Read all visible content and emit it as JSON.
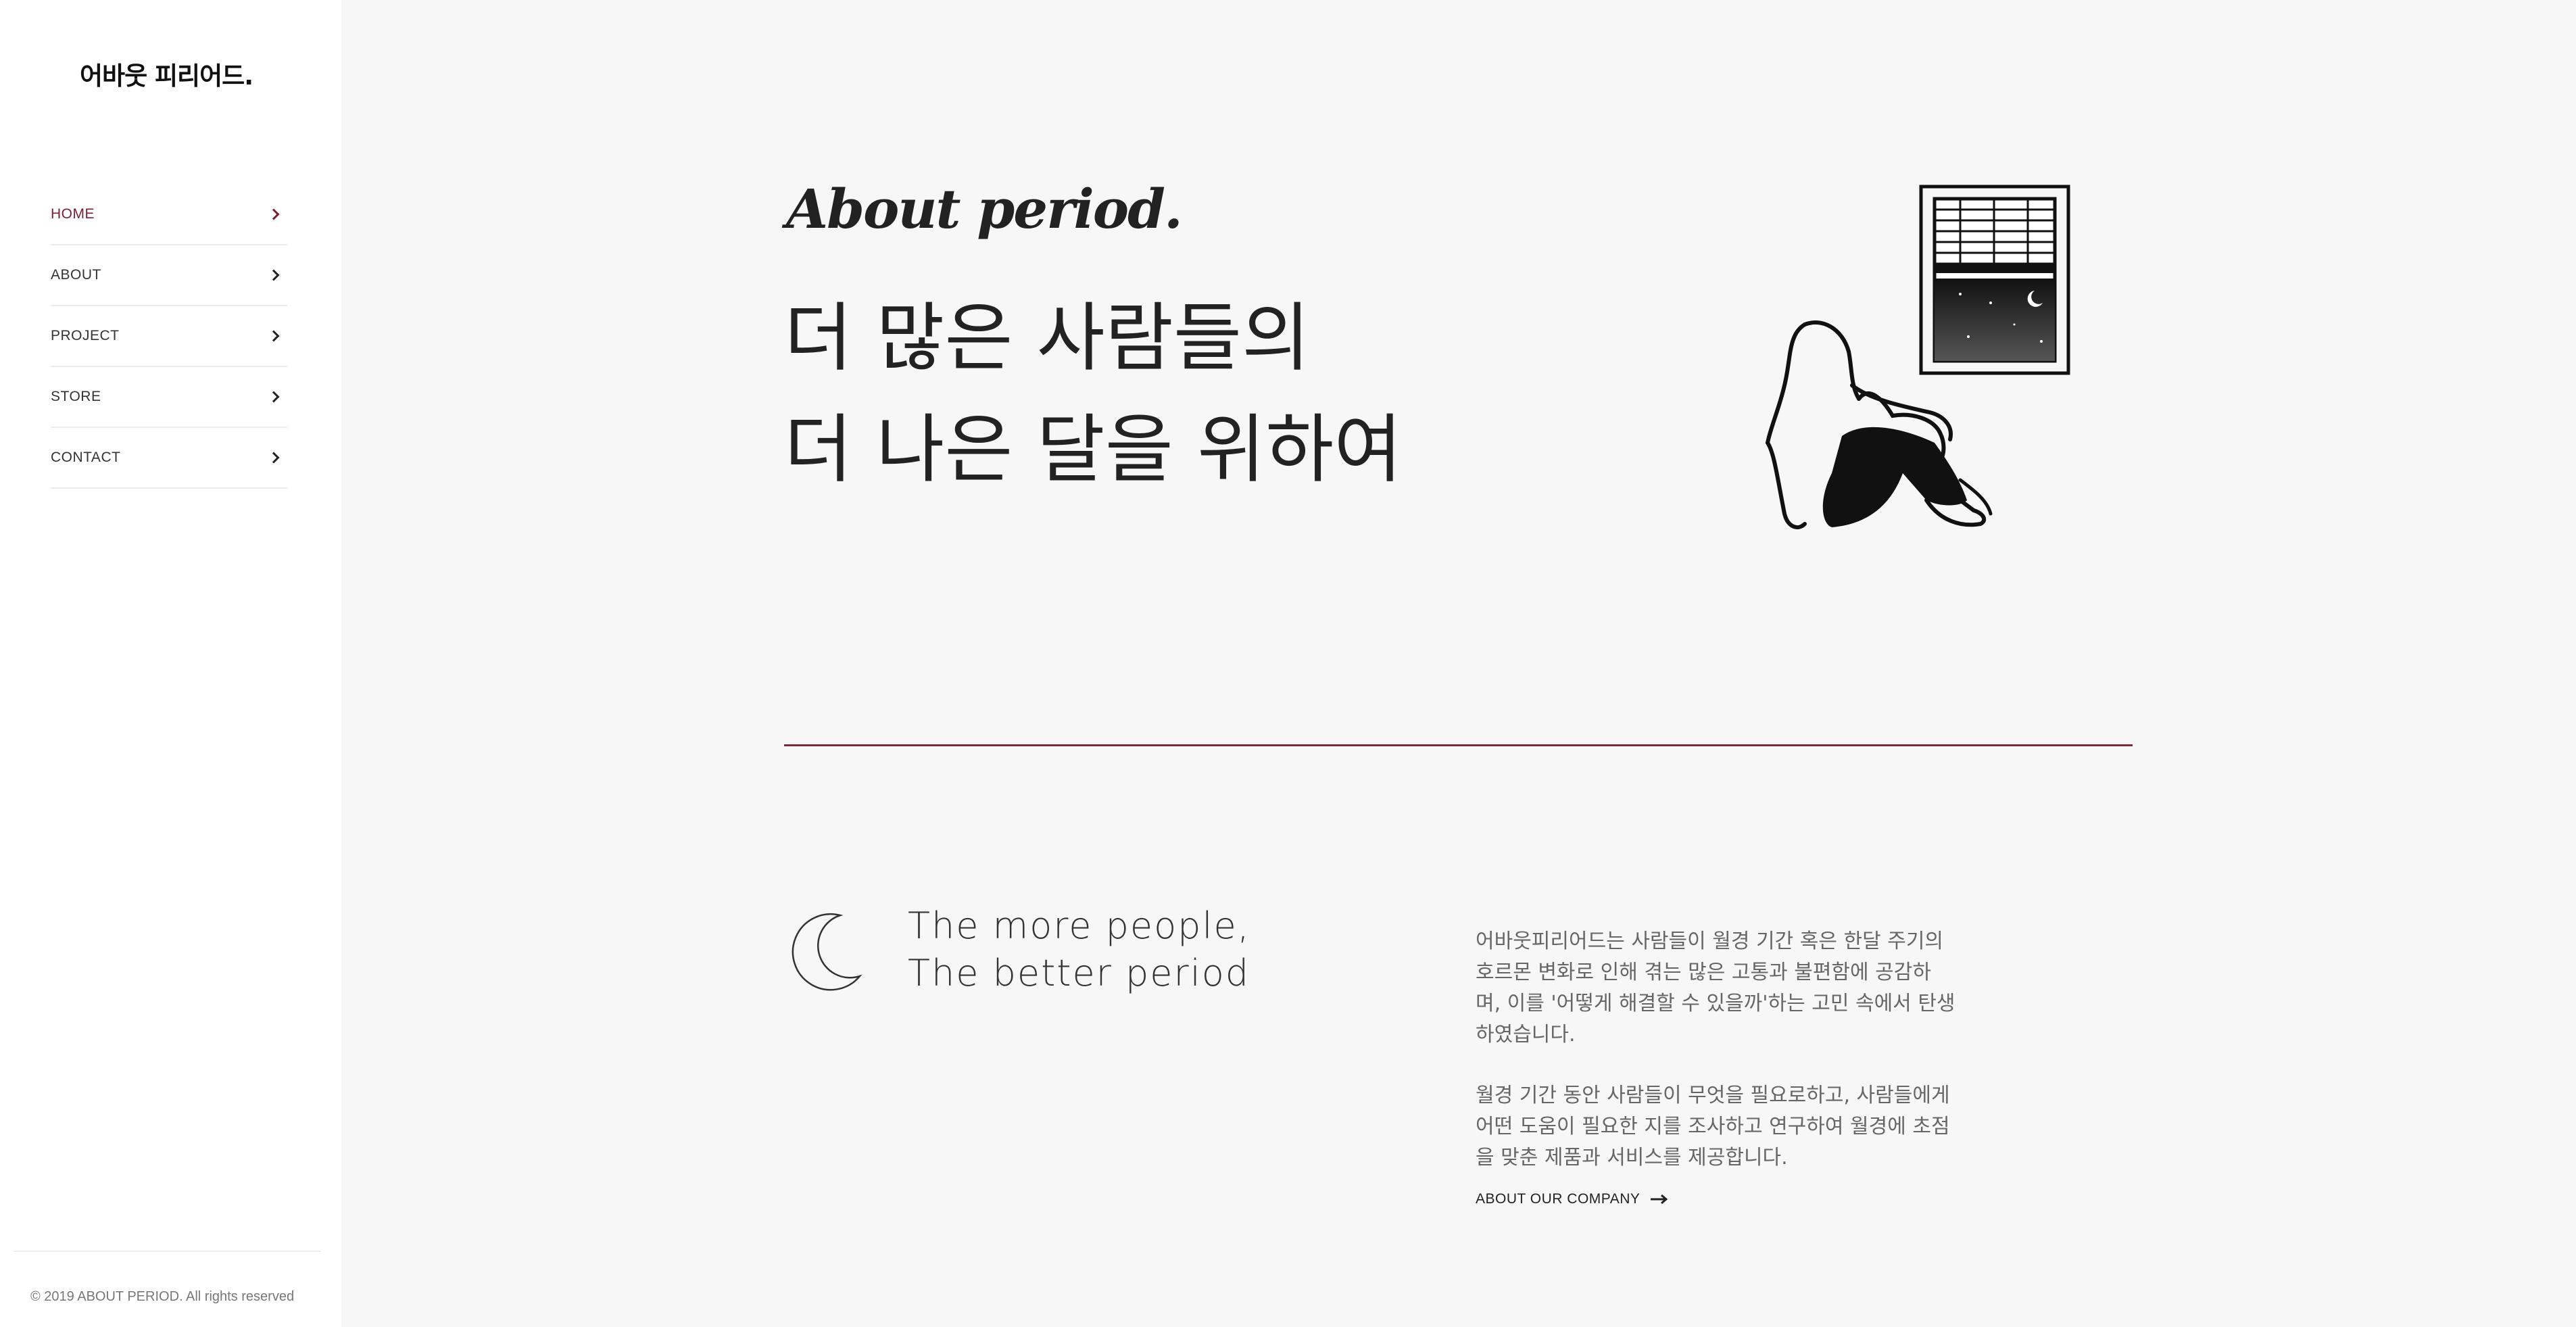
{
  "brand": {
    "logo_text": "어바웃 피리어드."
  },
  "nav": {
    "items": [
      {
        "label": "HOME",
        "active": true
      },
      {
        "label": "ABOUT",
        "active": false
      },
      {
        "label": "PROJECT",
        "active": false
      },
      {
        "label": "STORE",
        "active": false
      },
      {
        "label": "CONTACT",
        "active": false
      }
    ]
  },
  "footer": {
    "copyright": "© 2019 ABOUT PERIOD. All rights reserved"
  },
  "hero": {
    "script_title": "About period.",
    "line1": "더 많은 사람들의",
    "line2": "더 나은 달을 위하여",
    "illustration_icon": "woman-by-window-illustration"
  },
  "intro": {
    "icon": "crescent-moon-icon",
    "tagline_line1": "The more people,",
    "tagline_line2": "The better period",
    "paragraph1": "어바웃피리어드는 사람들이 월경 기간 혹은 한달 주기의 호르몬 변화로 인해 겪는 많은 고통과 불편함에 공감하며, 이를 '어떻게 해결할 수 있을까'하는 고민 속에서 탄생하였습니다.",
    "paragraph2": "월경 기간 동안 사람들이 무엇을 필요로하고, 사람들에게 어떤 도움이 필요한 지를 조사하고 연구하여 월경에 초점을 맞춘 제품과 서비스를 제공합니다.",
    "cta_label": "ABOUT OUR COMPANY"
  },
  "colors": {
    "accent": "#7a1f33",
    "background": "#f7f7f7",
    "sidebar": "#ffffff"
  }
}
